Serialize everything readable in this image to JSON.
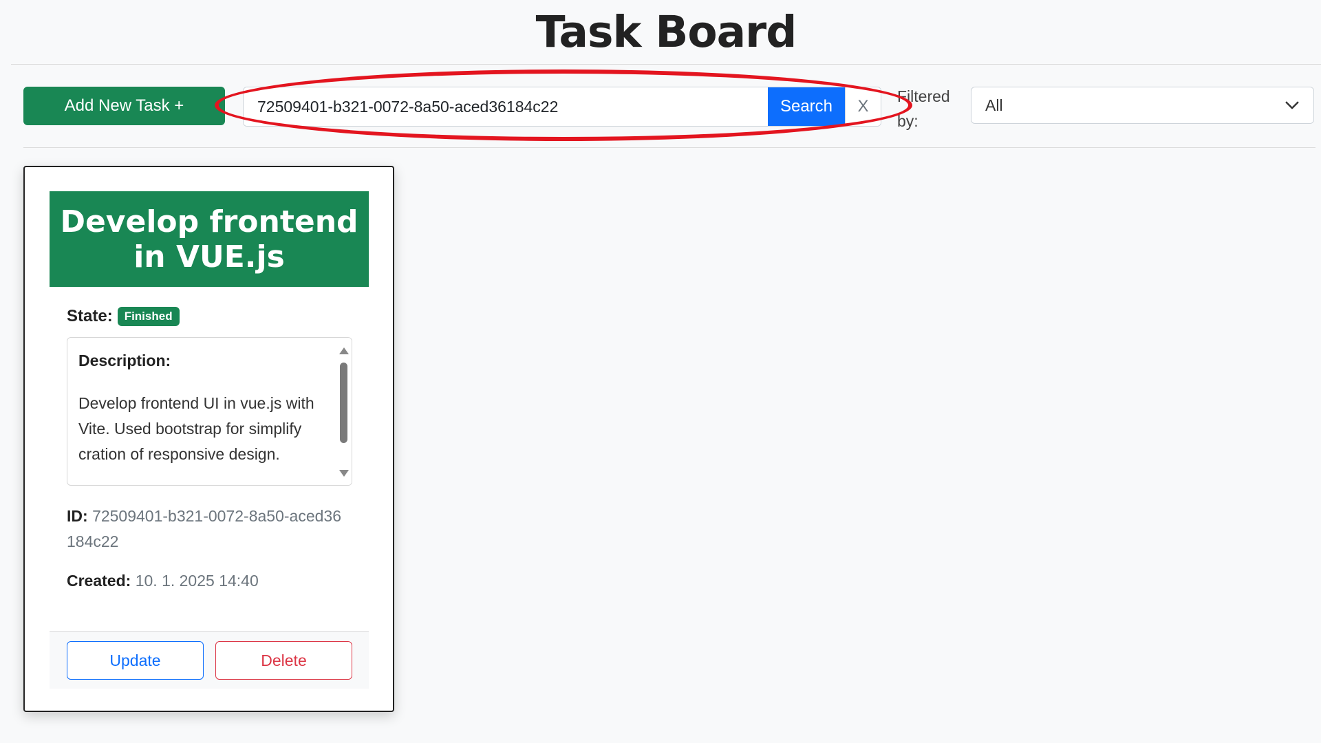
{
  "header": {
    "title": "Task Board"
  },
  "toolbar": {
    "add_label": "Add New Task +",
    "search_value": "72509401-b321-0072-8a50-aced36184c22",
    "search_label": "Search",
    "clear_label": "X",
    "filter_label": "Filtered by:",
    "filter_value": "All"
  },
  "task": {
    "title": "Develop frontend in VUE.js",
    "state_label": "State:",
    "state_value": "Finished",
    "description_label": "Description:",
    "description": "Develop frontend UI in vue.js with Vite. Used bootstrap for simplify cration of responsive design.",
    "id_label": "ID:",
    "id_value": "72509401-b321-0072-8a50-aced36184c22",
    "created_label": "Created:",
    "created_value": "10. 1. 2025 14:40",
    "update_label": "Update",
    "delete_label": "Delete"
  },
  "colors": {
    "success": "#198754",
    "primary": "#0d6efd",
    "danger": "#dc3545",
    "annotation": "#e3151f"
  }
}
